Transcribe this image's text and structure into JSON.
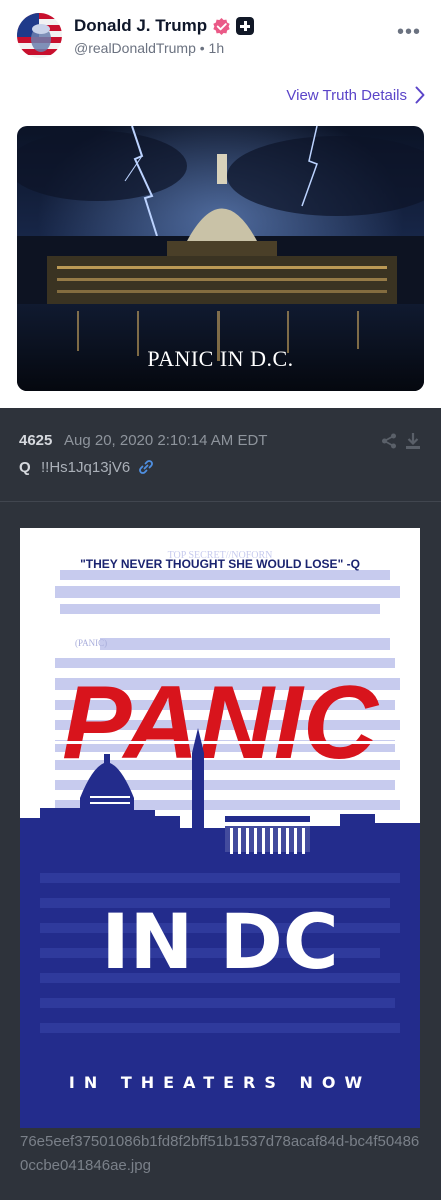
{
  "truth_post": {
    "author_name": "Donald J. Trump",
    "handle_line": "@realDonaldTrump • 1h",
    "more_icon": "more-icon",
    "view_details_label": "View Truth Details",
    "image_caption": "PANIC IN D.C.",
    "colors": {
      "accent": "#5b45c9",
      "verified": "#ea5a87"
    }
  },
  "q_post": {
    "number": "4625",
    "timestamp": "Aug 20, 2020 2:10:14 AM EDT",
    "q_label": "Q",
    "tripcode": "!!Hs1Jq13jV6",
    "filename": "76e5eef37501086b1fd8f2bff51b1537d78acaf84d-bc4f504860ccbe041846ae.jpg",
    "poster": {
      "stamp_text": "TOP SECRET//NOFORN",
      "quote": "\"THEY NEVER THOUGHT SHE WOULD LOSE\" -Q",
      "small_label": "(PANIC)",
      "title_word": "PANIC",
      "subtitle": "IN DC",
      "tagline": "IN THEATERS NOW",
      "colors": {
        "red": "#d8141c",
        "navy": "#232c8c"
      }
    },
    "colors": {
      "background": "#2e333b"
    }
  }
}
